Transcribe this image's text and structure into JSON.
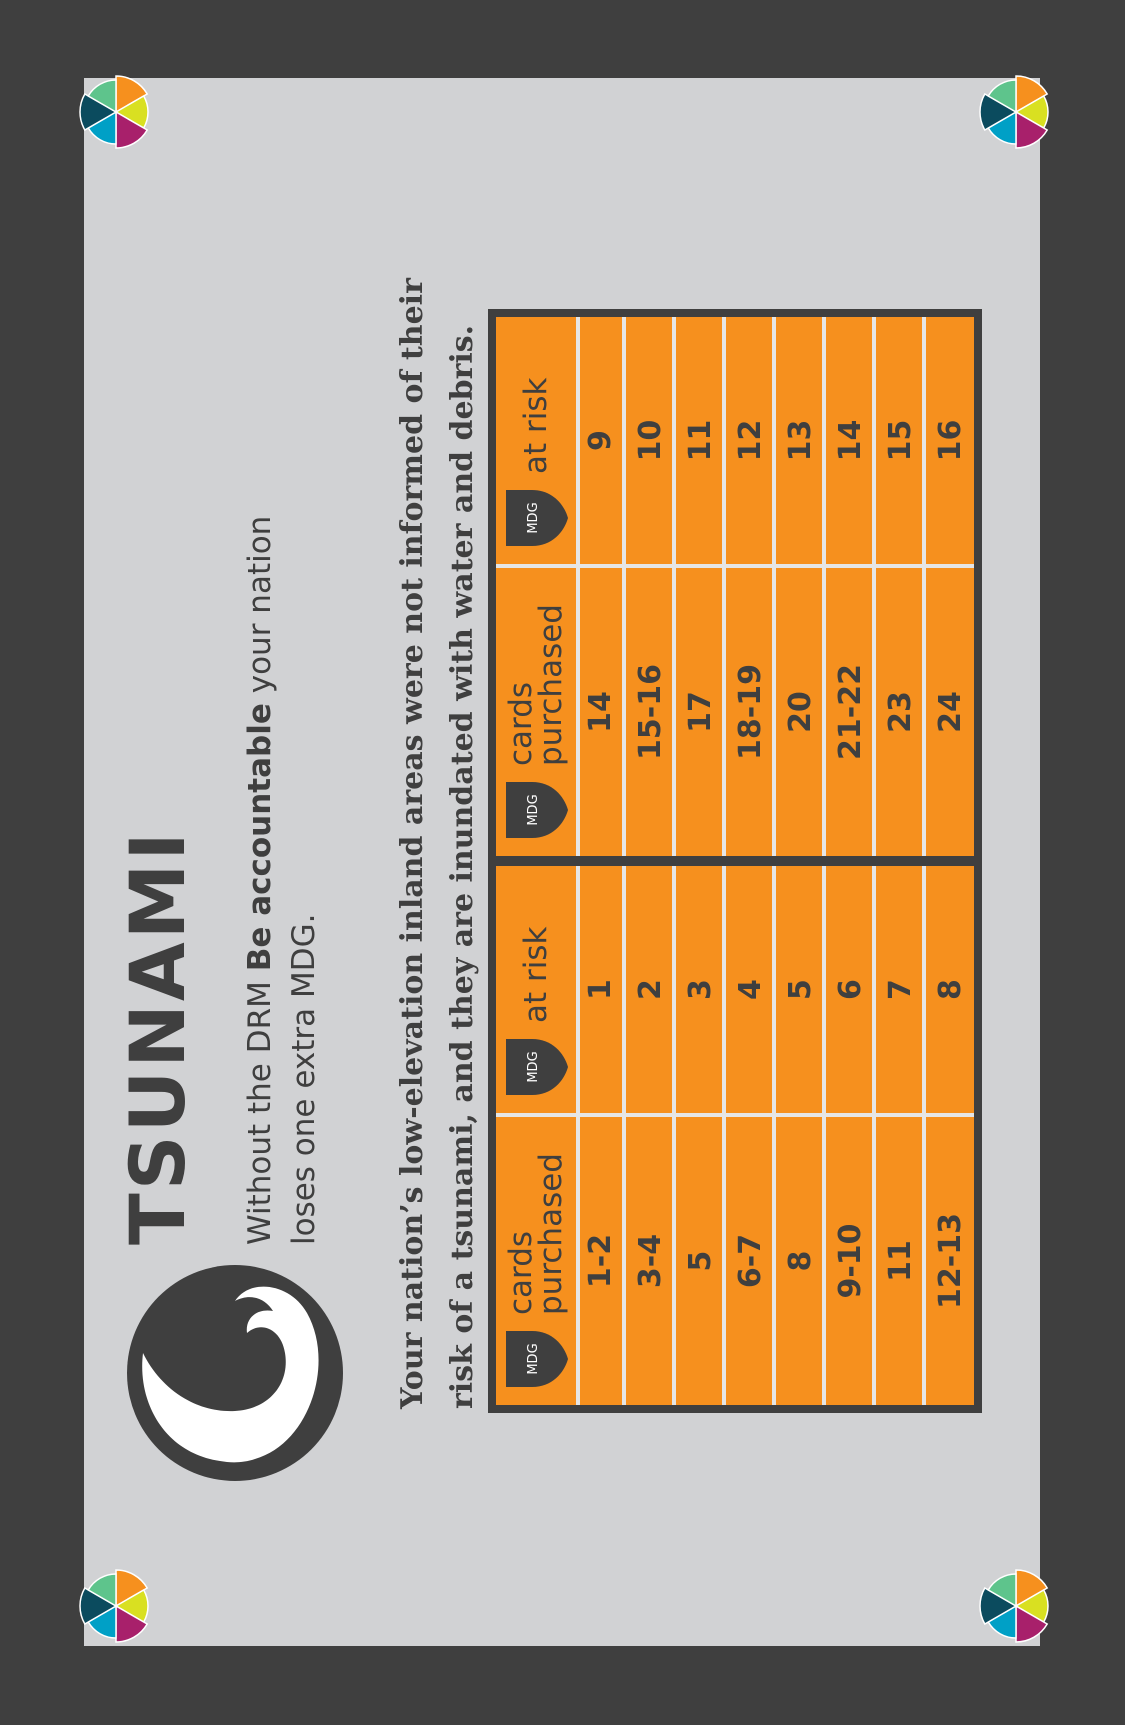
{
  "card": {
    "title": "TSUNAMI",
    "subtitle_pre": "Without the DRM ",
    "subtitle_bold": "Be accountable",
    "subtitle_post": " your nation loses one extra MDG.",
    "description": "Your nation’s low-elevation inland areas were not informed of their risk of a tsunami, and they are inundated with water and debris."
  },
  "table": {
    "shield_label": "MDG",
    "header_cards": "cards purchased",
    "header_risk": "at risk",
    "left_rows": [
      {
        "cards": "1-2",
        "risk": "1"
      },
      {
        "cards": "3-4",
        "risk": "2"
      },
      {
        "cards": "5",
        "risk": "3"
      },
      {
        "cards": "6-7",
        "risk": "4"
      },
      {
        "cards": "8",
        "risk": "5"
      },
      {
        "cards": "9-10",
        "risk": "6"
      },
      {
        "cards": "11",
        "risk": "7"
      },
      {
        "cards": "12-13",
        "risk": "8"
      }
    ],
    "right_rows": [
      {
        "cards": "14",
        "risk": "9"
      },
      {
        "cards": "15-16",
        "risk": "10"
      },
      {
        "cards": "17",
        "risk": "11"
      },
      {
        "cards": "18-19",
        "risk": "12"
      },
      {
        "cards": "20",
        "risk": "13"
      },
      {
        "cards": "21-22",
        "risk": "14"
      },
      {
        "cards": "23",
        "risk": "15"
      },
      {
        "cards": "24",
        "risk": "16"
      }
    ]
  },
  "colors": {
    "background": "#3f3f3f",
    "card": "#d1d2d4",
    "table_fill": "#f6901e",
    "divider": "#e6e6e6",
    "pinwheel": [
      "#f6901e",
      "#d9e021",
      "#a8206b",
      "#00a0c6",
      "#0b4b5e",
      "#5ec48c"
    ]
  },
  "icons": {
    "logo": "tsunami-wave-icon",
    "corner": "pinwheel-icon",
    "shield": "mdg-shield-icon"
  }
}
